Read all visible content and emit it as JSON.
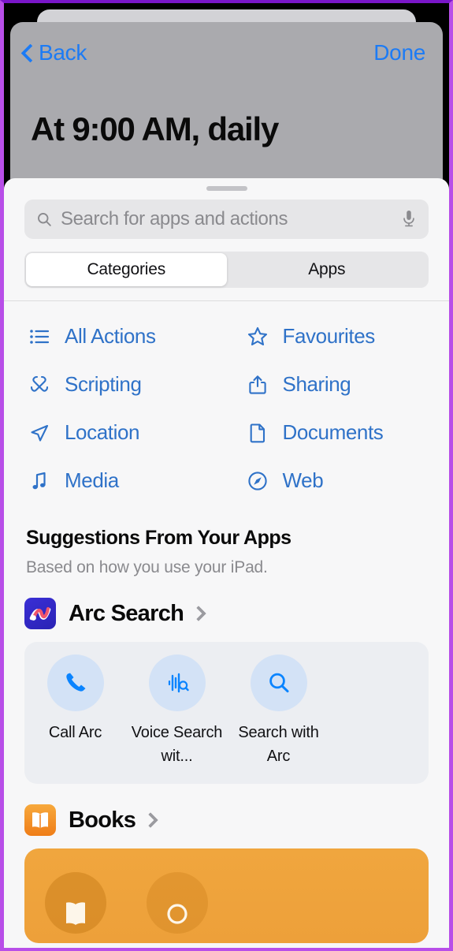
{
  "header": {
    "back_label": "Back",
    "back_icon": "chevron-left-icon",
    "done_label": "Done",
    "title": "At 9:00 AM, daily",
    "background_color": "#aaaaae",
    "accent_color": "#1c7bf5"
  },
  "sheet": {
    "grabber": "drag-handle",
    "background_color": "#f7f7f8"
  },
  "search": {
    "placeholder": "Search for apps and actions",
    "value": "",
    "leading_icon": "search-icon",
    "trailing_icon": "microphone-icon"
  },
  "segmented_control": {
    "selected": "Categories",
    "options": [
      {
        "label": "Categories",
        "selected": true
      },
      {
        "label": "Apps",
        "selected": false
      }
    ]
  },
  "categories": {
    "accent_color": "#2f72c8",
    "items": [
      {
        "label": "All Actions",
        "icon": "list-bullet-icon"
      },
      {
        "label": "Favourites",
        "icon": "star-icon"
      },
      {
        "label": "Scripting",
        "icon": "scripting-ribbon-icon"
      },
      {
        "label": "Sharing",
        "icon": "share-icon"
      },
      {
        "label": "Location",
        "icon": "location-arrow-icon"
      },
      {
        "label": "Documents",
        "icon": "document-page-icon"
      },
      {
        "label": "Media",
        "icon": "music-note-icon"
      },
      {
        "label": "Web",
        "icon": "compass-icon"
      }
    ]
  },
  "suggestions": {
    "title": "Suggestions From Your Apps",
    "subtitle": "Based on how you use your iPad."
  },
  "app_groups": [
    {
      "name": "Arc Search",
      "icon": "arc-search-app-icon",
      "icon_color": "#2e2abd",
      "chevron": "chevron-right-icon",
      "card_color": "#eceef2",
      "tiles": [
        {
          "label": "Call Arc",
          "icon": "phone-icon"
        },
        {
          "label": "Voice Search wit...",
          "icon": "voice-waveform-search-icon"
        },
        {
          "label": "Search with Arc",
          "icon": "magnifier-icon"
        }
      ]
    },
    {
      "name": "Books",
      "icon": "books-app-icon",
      "icon_color": "#f08a1e",
      "chevron": "chevron-right-icon",
      "card_color": "#eda03a",
      "tiles": [
        {
          "label": "",
          "icon": "open-book-icon"
        },
        {
          "label": "",
          "icon": "magnifier-icon"
        }
      ]
    }
  ]
}
